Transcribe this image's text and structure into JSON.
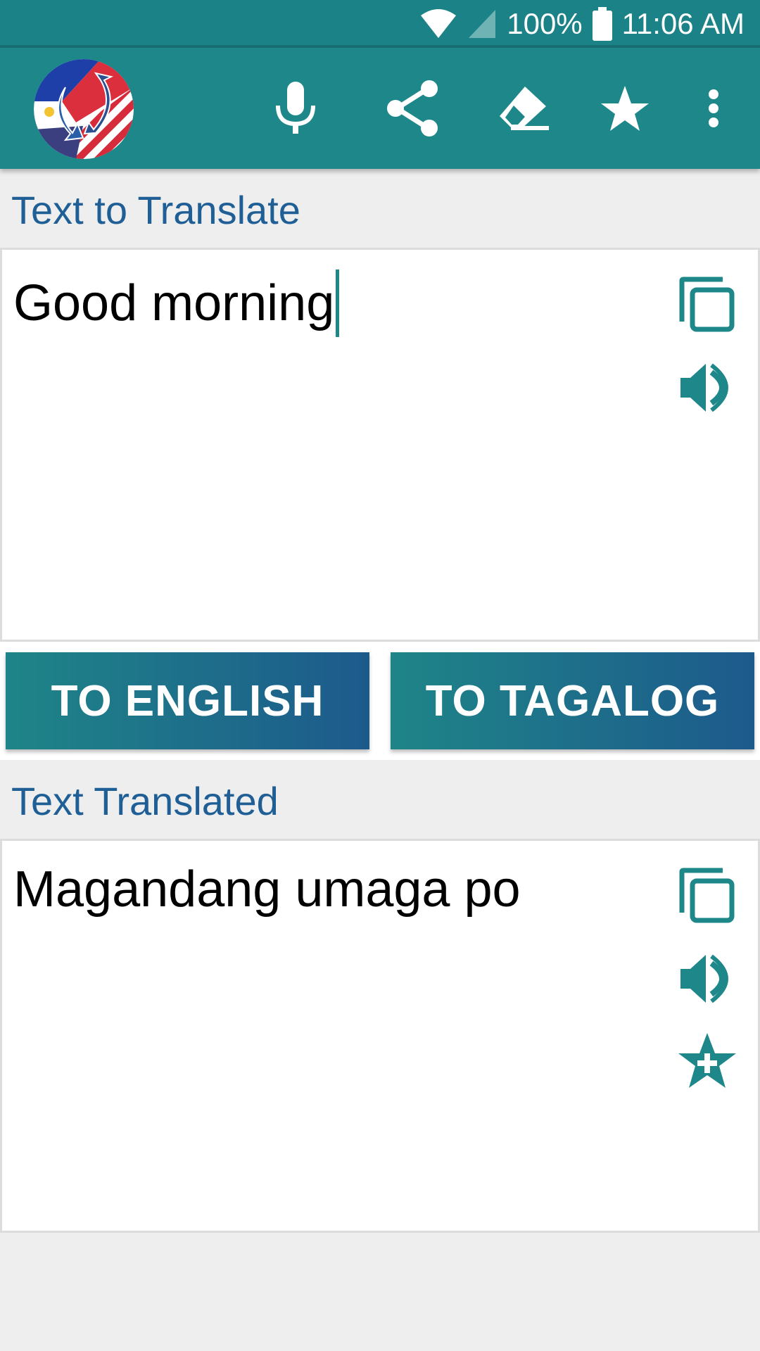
{
  "status_bar": {
    "battery": "100%",
    "time": "11:06 AM",
    "icons": [
      "wifi-icon",
      "cell-signal-icon",
      "battery-icon"
    ]
  },
  "app_bar": {
    "logo": "philippines-usa-translate-logo",
    "actions": [
      {
        "name": "microphone",
        "icon": "mic-icon"
      },
      {
        "name": "share",
        "icon": "share-icon"
      },
      {
        "name": "clear",
        "icon": "eraser-icon"
      },
      {
        "name": "favorites",
        "icon": "star-icon"
      },
      {
        "name": "more",
        "icon": "more-vert-icon"
      }
    ]
  },
  "source": {
    "label": "Text to Translate",
    "value": "Good morning",
    "actions": [
      "copy-icon",
      "speaker-icon"
    ]
  },
  "buttons": {
    "to_english": "TO ENGLISH",
    "to_tagalog": "TO TAGALOG"
  },
  "target": {
    "label": "Text Translated",
    "value": "Magandang umaga po",
    "actions": [
      "copy-icon",
      "speaker-icon",
      "star-add-icon"
    ]
  },
  "colors": {
    "primary": "#1e878a",
    "status_bar": "#1b8287",
    "label_blue": "#1f5f96",
    "gradient_end": "#1d5a8c",
    "background": "#eeeeee"
  }
}
